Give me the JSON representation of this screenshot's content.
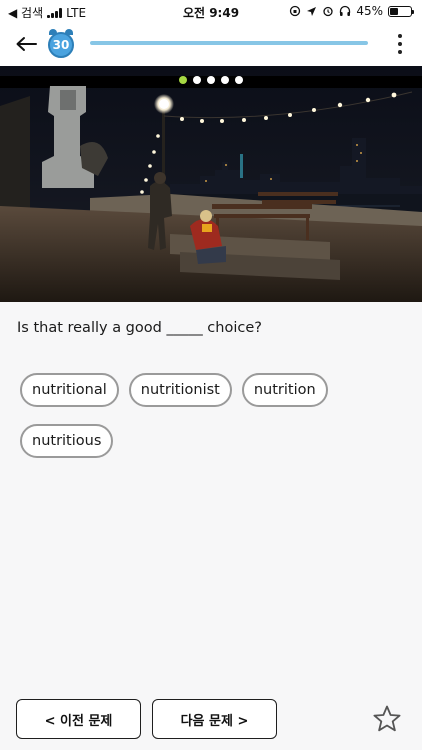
{
  "status_bar": {
    "back_app": "◀ 검색",
    "network": "LTE",
    "time": "오전 9:49",
    "battery_text": "45%",
    "battery_level": 0.45
  },
  "header": {
    "timer_value": "30",
    "progress_fraction": 1.0,
    "icons": {
      "back": "arrow-left-icon",
      "timer": "alarm-clock-icon",
      "more": "more-vertical-icon"
    }
  },
  "video": {
    "slide_count": 5,
    "active_slide": 0,
    "active_color": "#a6d843"
  },
  "question": {
    "text": "Is that really a good _____ choice?"
  },
  "choices": [
    {
      "label": "nutritional"
    },
    {
      "label": "nutritionist"
    },
    {
      "label": "nutrition"
    },
    {
      "label": "nutritious"
    }
  ],
  "footer": {
    "prev_label": "< 이전 문제",
    "next_label": "다음 문제 >",
    "bookmark_icon": "star-outline-icon"
  },
  "colors": {
    "accent": "#4aa3df",
    "progress": "#87c6e6",
    "chip_border": "#9a9a9a"
  }
}
